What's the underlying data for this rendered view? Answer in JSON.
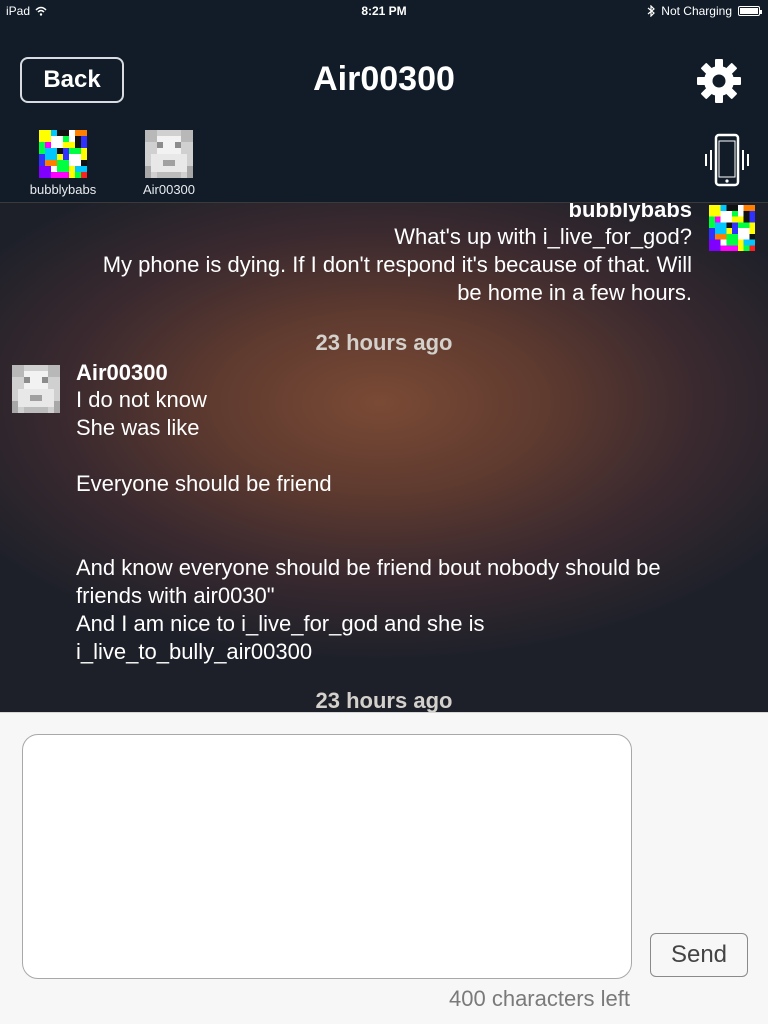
{
  "status_bar": {
    "device": "iPad",
    "time": "8:21 PM",
    "battery_status": "Not Charging",
    "icons": [
      "wifi-icon",
      "bluetooth-icon",
      "battery-icon"
    ]
  },
  "header": {
    "back_label": "Back",
    "title": "Air00300",
    "settings_icon": "gear-icon",
    "vibrate_icon": "phone-vibrate-icon"
  },
  "participants": [
    {
      "name": "bubblybabs",
      "avatar": "colorful-pixel-avatar"
    },
    {
      "name": "Air00300",
      "avatar": "gray-pixel-avatar"
    }
  ],
  "messages": [
    {
      "author": "bubblybabs",
      "lines": "What's up with i_live_for_god?\nMy phone is dying.  If I don't respond it's because of that.  Will\nbe home in a few hours."
    },
    {
      "timestamp": "23 hours ago"
    },
    {
      "author": "Air00300",
      "lines": "I do not know\nShe was like\n\nEveryone should be friend\n\n\nAnd know everyone should be friend bout nobody should be\nfriends with air0030\"\nAnd I am nice to i_live_for_god and she is\ni_live_to_bully_air00300"
    },
    {
      "timestamp": "23 hours ago"
    }
  ],
  "compose": {
    "input_value": "",
    "send_label": "Send",
    "char_count": "400 characters left"
  },
  "colors": {
    "header_bg": "#111c28",
    "compose_bg": "#f7f7f7",
    "chat_glow": "#7a4a35"
  }
}
